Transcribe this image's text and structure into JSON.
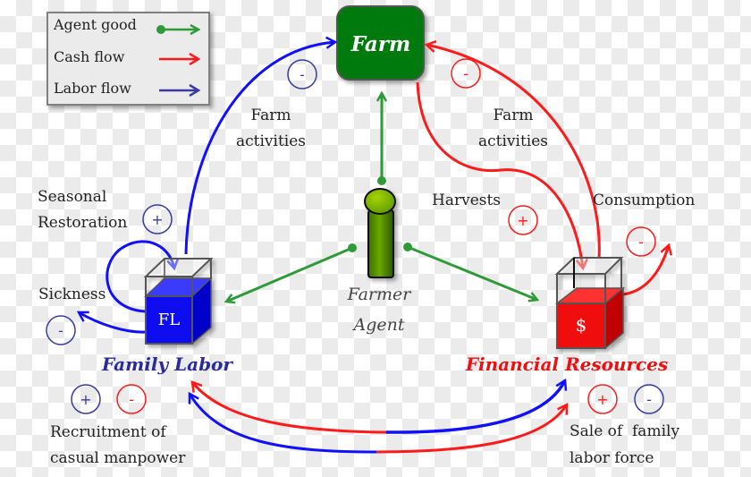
{
  "colors": {
    "agent_good": "#2e9a38",
    "cash_flow": "#ff1a1a",
    "labor_flow": "#1010ff",
    "labor_sign": "#3a3aa0",
    "farm_green": "#007a0a",
    "fl_blue": "#0a0af0",
    "fr_red": "#f00a0a"
  },
  "legend": {
    "items": [
      {
        "label": "Agent good",
        "icon": "green-dot-arrow"
      },
      {
        "label": "Cash flow",
        "icon": "red-arrow"
      },
      {
        "label": "Labor flow",
        "icon": "blue-arrow"
      }
    ]
  },
  "nodes": {
    "farm": {
      "label": "Farm"
    },
    "family_labor": {
      "box_label": "FL",
      "title": "Family Labor"
    },
    "financial_resources": {
      "box_label": "$",
      "title": "Financial Resources"
    },
    "farmer_agent": {
      "line1": "Farmer",
      "line2": "Agent"
    }
  },
  "labels": {
    "farm_activities_left": {
      "line1": "Farm",
      "line2": "activities",
      "sign": "-"
    },
    "farm_activities_right": {
      "line1": "Farm",
      "line2": "activities",
      "sign": "-"
    },
    "harvests": {
      "text": "Harvests",
      "sign": "+"
    },
    "consumption": {
      "text": "Consumption",
      "sign": "-"
    },
    "seasonal_restoration": {
      "line1": "Seasonal",
      "line2": "Restoration",
      "sign": "+"
    },
    "sickness": {
      "text": "Sickness",
      "sign": "-"
    },
    "recruitment": {
      "line1": "Recruitment of",
      "line2": "casual manpower",
      "sign_labor": "+",
      "sign_cash": "-"
    },
    "sale": {
      "line1": "Sale of  family",
      "line2": "labor force",
      "sign_cash": "+",
      "sign_labor": "-"
    }
  }
}
